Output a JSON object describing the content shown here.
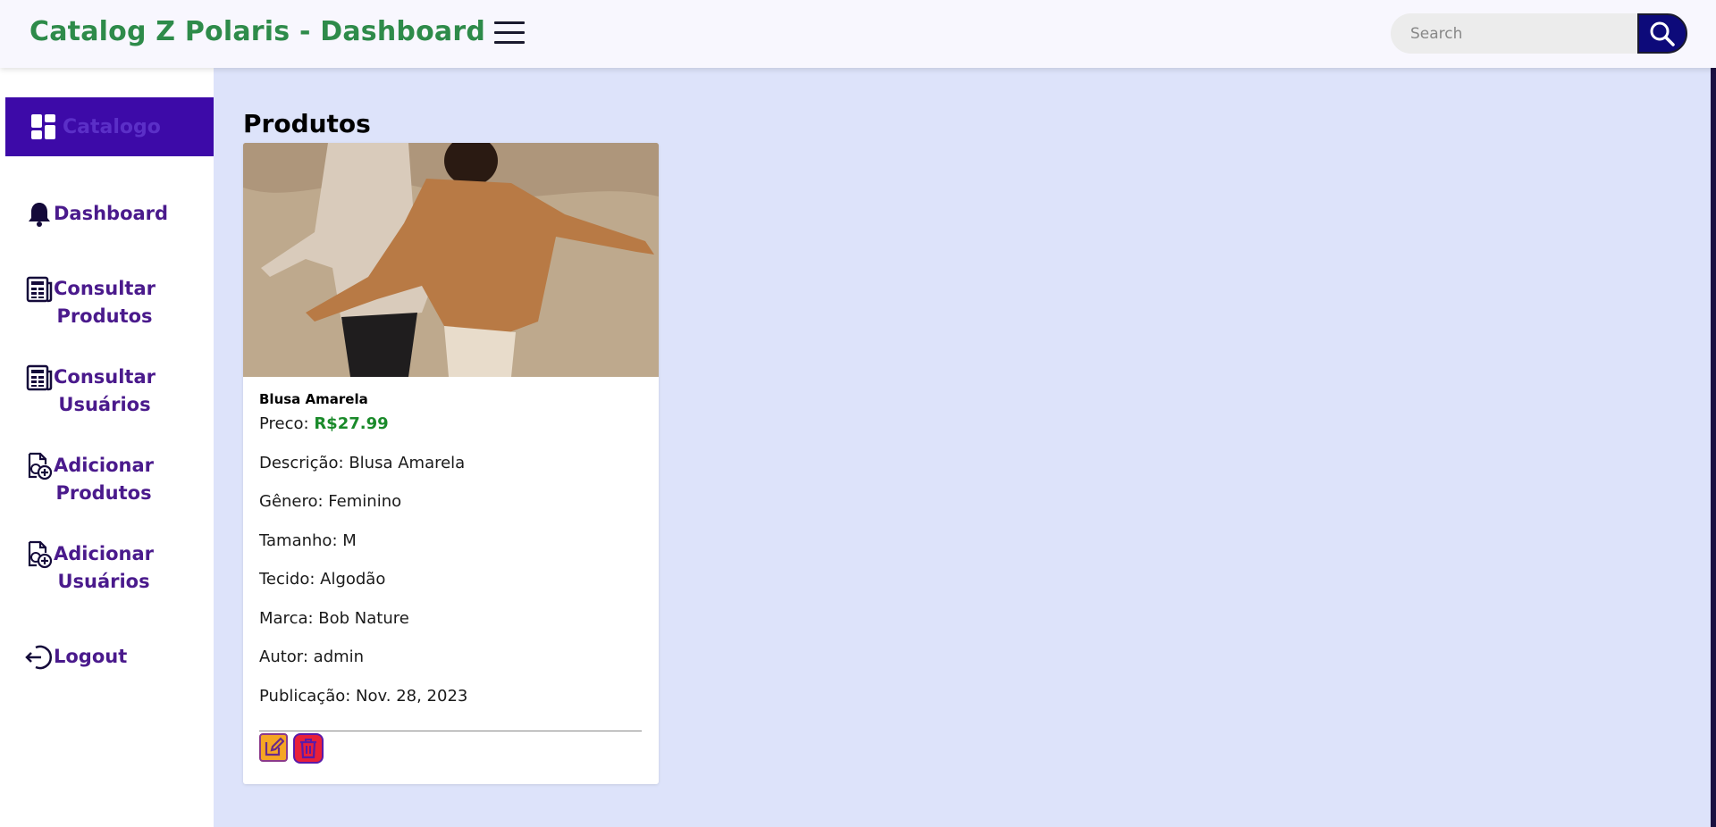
{
  "header": {
    "title": "Catalog Z Polaris - Dashboard",
    "search_placeholder": "Search"
  },
  "sidebar": {
    "active": {
      "label": "Catalogo",
      "icon": "grid-icon"
    },
    "items": [
      {
        "label": "Dashboard",
        "icon": "bell-icon"
      },
      {
        "label_line1": "Consultar",
        "label_line2": "Produtos",
        "icon": "table-icon"
      },
      {
        "label_line1": "Consultar",
        "label_line2": "Usuários",
        "icon": "table-icon"
      },
      {
        "label_line1": "Adicionar",
        "label_line2": "Produtos",
        "icon": "file-add-icon"
      },
      {
        "label_line1": "Adicionar",
        "label_line2": "Usuários",
        "icon": "file-add-icon"
      },
      {
        "label": "Logout",
        "icon": "logout-icon"
      }
    ]
  },
  "main": {
    "title": "Produtos",
    "product": {
      "name": "Blusa Amarela",
      "price_label": "Preco: ",
      "price_value": "R$27.99",
      "description": "Descrição: Blusa Amarela",
      "gender": "Gênero: Feminino",
      "size": "Tamanho: M",
      "fabric": "Tecido: Algodão",
      "brand": "Marca: Bob Nature",
      "author": "Autor: admin",
      "published": "Publicação: Nov. 28, 2023"
    }
  },
  "colors": {
    "brand_green": "#2e8b4a",
    "sidebar_text": "#4a1a8c",
    "active_bg": "#3d0aa8",
    "price_green": "#1a8a2a",
    "edit_orange": "#f5a623",
    "delete_red": "#e8203a"
  }
}
